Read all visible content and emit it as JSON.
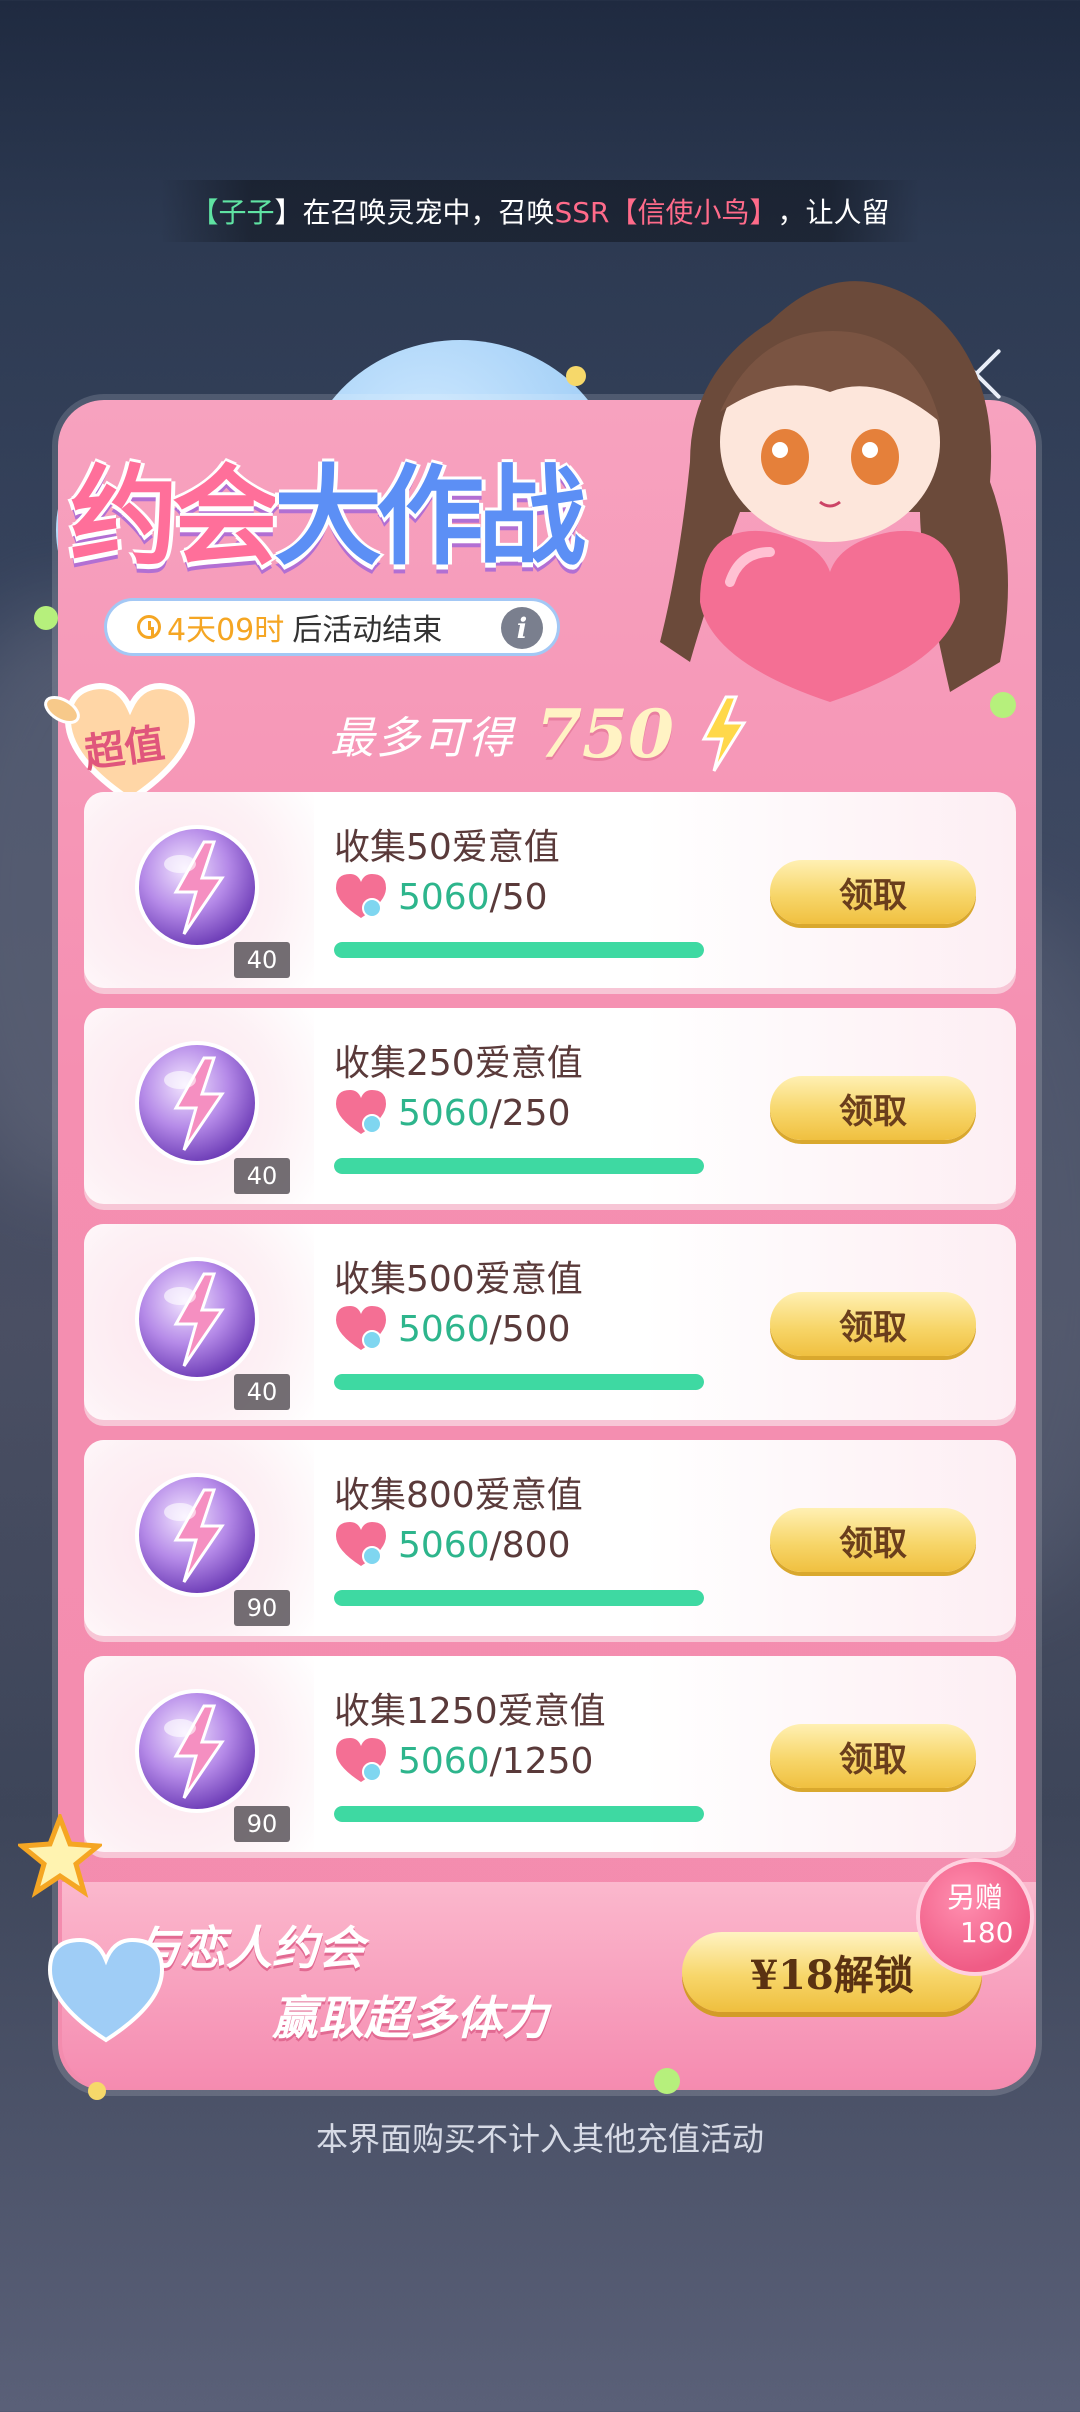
{
  "marquee": {
    "prefix": "【",
    "user": "子子",
    "mid": "】在召唤灵宠中，召唤",
    "item": "SSR【信使小鸟】",
    "suffix": "，让人留"
  },
  "close_icon": "close-icon",
  "event": {
    "title_pink": "约会",
    "title_blue": "大作战",
    "timer_value": "4天09时",
    "timer_suffix": "后活动结束",
    "info_label": "i",
    "badge": "超值",
    "max_label": "最多可得",
    "max_value": "750"
  },
  "rows": [
    {
      "title": "收集50爱意值",
      "current": "5060",
      "target": "/50",
      "count": "40",
      "button": "领取",
      "progress": 1.0
    },
    {
      "title": "收集250爱意值",
      "current": "5060",
      "target": "/250",
      "count": "40",
      "button": "领取",
      "progress": 1.0
    },
    {
      "title": "收集500爱意值",
      "current": "5060",
      "target": "/500",
      "count": "40",
      "button": "领取",
      "progress": 1.0
    },
    {
      "title": "收集800爱意值",
      "current": "5060",
      "target": "/800",
      "count": "90",
      "button": "领取",
      "progress": 1.0
    },
    {
      "title": "收集1250爱意值",
      "current": "5060",
      "target": "/1250",
      "count": "90",
      "button": "领取",
      "progress": 1.0
    }
  ],
  "banner": {
    "line1": "与恋人约会",
    "line2": "赢取超多体力",
    "unlock_button": "¥18解锁",
    "bonus_label": "另赠",
    "bonus_value": "180"
  },
  "footer_note": "本界面购买不计入其他充值活动",
  "colors": {
    "accent_pink": "#f58fb1",
    "progress_green": "#3ed9a2",
    "button_gold": "#f7d66a"
  }
}
